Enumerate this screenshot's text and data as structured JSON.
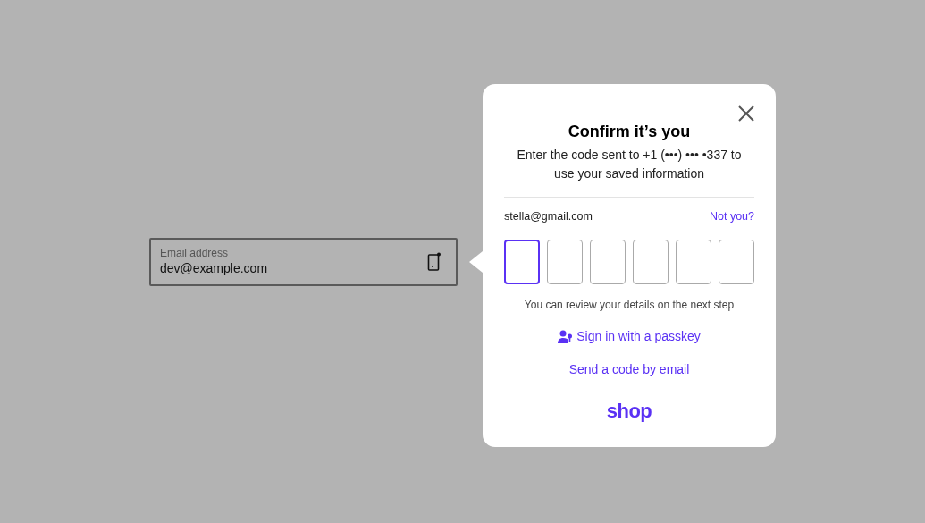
{
  "email_field": {
    "label": "Email address",
    "value": "dev@example.com"
  },
  "popover": {
    "title": "Confirm it’s you",
    "message": "Enter the code sent to +1 (•••) ••• •337 to use your saved information",
    "account_email": "stella@gmail.com",
    "not_you_link": "Not you?",
    "code_boxes": [
      {
        "selected": true
      },
      {
        "selected": false
      },
      {
        "selected": false
      },
      {
        "selected": false
      },
      {
        "selected": false
      },
      {
        "selected": false
      }
    ],
    "hint": "You can review your details on the next step",
    "passkey_link": "Sign in with a passkey",
    "email_code_link": "Send a code by email",
    "logo": "shop"
  }
}
